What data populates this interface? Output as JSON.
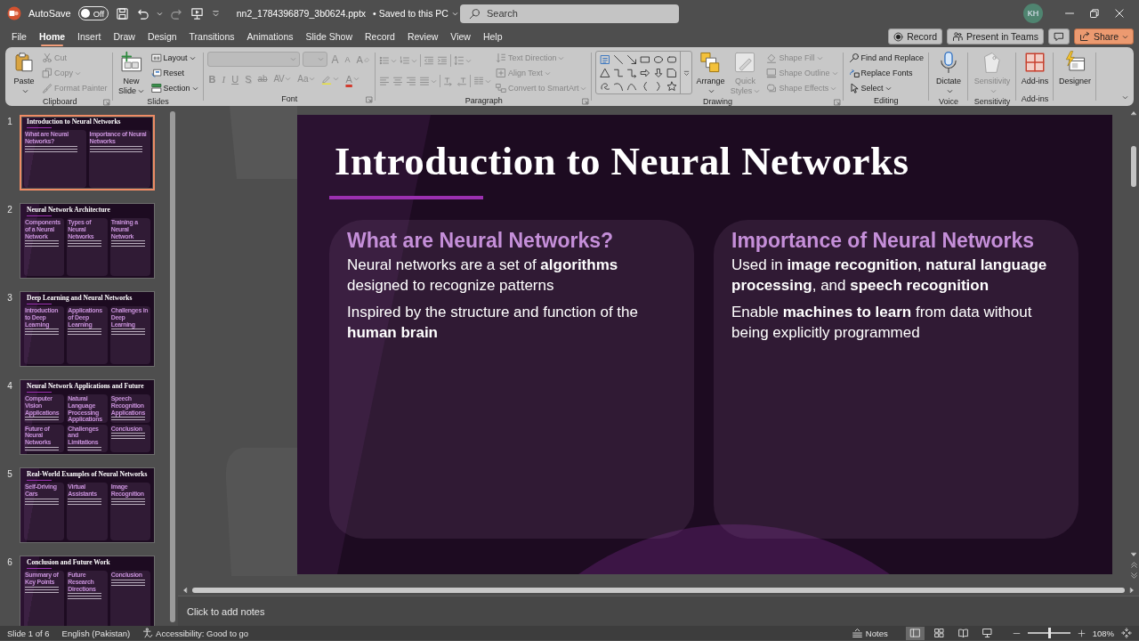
{
  "title_bar": {
    "autosave_label": "AutoSave",
    "autosave": {
      "on": false,
      "label": "Off"
    },
    "file_name": "nn2_1784396879_3b0624.pptx",
    "save_status": "• Saved to this PC",
    "search": {
      "placeholder": "Search"
    },
    "account_initials": "KH"
  },
  "tabs": [
    {
      "label": "File",
      "selected": false
    },
    {
      "label": "Home",
      "selected": true
    },
    {
      "label": "Insert",
      "selected": false
    },
    {
      "label": "Draw",
      "selected": false
    },
    {
      "label": "Design",
      "selected": false
    },
    {
      "label": "Transitions",
      "selected": false
    },
    {
      "label": "Animations",
      "selected": false
    },
    {
      "label": "Slide Show",
      "selected": false
    },
    {
      "label": "Record",
      "selected": false
    },
    {
      "label": "Review",
      "selected": false
    },
    {
      "label": "View",
      "selected": false
    },
    {
      "label": "Help",
      "selected": false
    }
  ],
  "header_buttons": [
    {
      "kind": "record",
      "label": "Record"
    },
    {
      "kind": "teams",
      "label": "Present in Teams"
    },
    {
      "kind": "comments"
    },
    {
      "kind": "share",
      "label": "Share"
    }
  ],
  "ribbon": {
    "groups": [
      {
        "label": "Clipboard",
        "launcher": true,
        "columns": [
          {
            "kind": "large",
            "label": "Paste",
            "caret": true,
            "disabled": false
          },
          {
            "kind": "stack",
            "buttons": [
              {
                "label": "Cut",
                "disabled": true
              },
              {
                "label": "Copy",
                "caret": true,
                "disabled": true
              },
              {
                "label": "Format Painter",
                "disabled": true
              }
            ]
          }
        ]
      },
      {
        "label": "Slides",
        "columns": [
          {
            "kind": "large",
            "label": "New Slide",
            "caret": true,
            "disabled": false
          },
          {
            "kind": "stack",
            "buttons": [
              {
                "label": "Layout",
                "caret": true,
                "disabled": false
              },
              {
                "label": "Reset",
                "disabled": false
              },
              {
                "label": "Section",
                "caret": true,
                "disabled": false
              }
            ]
          }
        ]
      },
      {
        "label": "Font",
        "launcher": true,
        "columns": [
          {
            "kind": "font",
            "disabled": true,
            "row1": [
              {
                "glyph": "A",
                "kind": "grow"
              },
              {
                "glyph": "A",
                "kind": "shrink"
              },
              {
                "glyph": "A",
                "kind": "clear"
              }
            ],
            "row2": [
              {
                "glyph": "B",
                "kind": "bold"
              },
              {
                "glyph": "I",
                "kind": "italic"
              },
              {
                "glyph": "U",
                "kind": "underline"
              },
              {
                "glyph": "S",
                "kind": "shadow"
              },
              {
                "glyph": "ab",
                "kind": "strike"
              },
              {
                "glyph": "AV",
                "kind": "spacing",
                "caret": true
              },
              {
                "glyph": "Aa",
                "kind": "case",
                "caret": true
              },
              {
                "kind": "highlight",
                "caret": true
              },
              {
                "glyph": "A",
                "kind": "color",
                "caret": true
              }
            ]
          }
        ]
      },
      {
        "label": "Paragraph",
        "launcher": true,
        "columns": [
          {
            "kind": "paragraph",
            "disabled": true
          },
          {
            "kind": "stack",
            "buttons": [
              {
                "label": "Text Direction",
                "caret": true,
                "disabled": true
              },
              {
                "label": "Align Text",
                "caret": true,
                "disabled": true
              },
              {
                "label": "Convert to SmartArt",
                "caret": true,
                "disabled": true
              }
            ]
          }
        ]
      },
      {
        "label": "Drawing",
        "launcher": true,
        "columns": [
          {
            "kind": "shapes"
          },
          {
            "kind": "large",
            "label": "Arrange",
            "caret": true,
            "disabled": false
          },
          {
            "kind": "large",
            "label": "Quick Styles",
            "caret": true,
            "disabled": true
          },
          {
            "kind": "stack",
            "buttons": [
              {
                "label": "Shape Fill",
                "caret": true,
                "disabled": true
              },
              {
                "label": "Shape Outline",
                "caret": true,
                "disabled": true
              },
              {
                "label": "Shape Effects",
                "caret": true,
                "disabled": true
              }
            ]
          }
        ]
      },
      {
        "label": "Editing",
        "columns": [
          {
            "kind": "stack",
            "buttons": [
              {
                "label": "Find and Replace",
                "disabled": false
              },
              {
                "label": "Replace Fonts",
                "disabled": false
              },
              {
                "label": "Select",
                "caret": true,
                "disabled": false
              }
            ]
          }
        ]
      },
      {
        "label": "Voice",
        "columns": [
          {
            "kind": "large",
            "label": "Dictate",
            "caret": true,
            "disabled": false
          }
        ]
      },
      {
        "label": "Sensitivity",
        "columns": [
          {
            "kind": "large",
            "label": "Sensitivity",
            "caret": true,
            "disabled": true
          }
        ]
      },
      {
        "label": "Add-ins",
        "columns": [
          {
            "kind": "large",
            "label": "Add-ins",
            "disabled": false
          }
        ]
      },
      {
        "columns": [
          {
            "kind": "large",
            "label": "Designer",
            "disabled": false
          }
        ]
      }
    ]
  },
  "slides": [
    {
      "number": "1",
      "title": "Introduction to Neural Networks",
      "selected": true,
      "cards": [
        {
          "heading": "What are Neural Networks?"
        },
        {
          "heading": "Importance of Neural Networks"
        }
      ]
    },
    {
      "number": "2",
      "title": "Neural Network Architecture",
      "selected": false,
      "cards": [
        {
          "heading": "Components of a Neural Network"
        },
        {
          "heading": "Types of Neural Networks"
        },
        {
          "heading": "Training a Neural Network"
        }
      ]
    },
    {
      "number": "3",
      "title": "Deep Learning and Neural Networks",
      "selected": false,
      "cards": [
        {
          "heading": "Introduction to Deep Learning"
        },
        {
          "heading": "Applications of Deep Learning"
        },
        {
          "heading": "Challenges in Deep Learning"
        }
      ]
    },
    {
      "number": "4",
      "title": "Neural Network Applications and Future",
      "selected": false,
      "cards": [
        {
          "heading": "Computer Vision Applications"
        },
        {
          "heading": "Natural Language Processing Applications"
        },
        {
          "heading": "Speech Recognition Applications"
        },
        {
          "heading": "Future of Neural Networks"
        },
        {
          "heading": "Challenges and Limitations"
        },
        {
          "heading": "Conclusion"
        }
      ]
    },
    {
      "number": "5",
      "title": "Real-World Examples of Neural Networks",
      "selected": false,
      "cards": [
        {
          "heading": "Self-Driving Cars"
        },
        {
          "heading": "Virtual Assistants"
        },
        {
          "heading": "Image Recognition"
        }
      ]
    },
    {
      "number": "6",
      "title": "Conclusion and Future Work",
      "selected": false,
      "cards": [
        {
          "heading": "Summary of Key Points"
        },
        {
          "heading": "Future Research Directions"
        },
        {
          "heading": "Conclusion"
        }
      ]
    }
  ],
  "slide": {
    "title": "Introduction to Neural Networks",
    "cards": [
      {
        "heading": "What are Neural Networks?",
        "paragraphs": [
          "Neural networks are a set of **algorithms** designed to recognize patterns",
          "Inspired by the structure and function of the **human brain**"
        ]
      },
      {
        "heading": "Importance of Neural Networks",
        "paragraphs": [
          "Used in **image recognition**, **natural language processing**, and **speech recognition**",
          "Enable **machines to learn** from data without being explicitly programmed"
        ]
      }
    ]
  },
  "notes": {
    "placeholder": "Click to add notes"
  },
  "status_bar": {
    "slide_position": "Slide 1 of 6",
    "language": "English (Pakistan)",
    "accessibility": "Accessibility: Good to go",
    "notes_label": "Notes",
    "views": [
      {
        "selected": true
      },
      {
        "selected": false
      },
      {
        "selected": false
      },
      {
        "selected": false
      }
    ],
    "zoom": {
      "level": 0.52,
      "label": "108%"
    }
  }
}
